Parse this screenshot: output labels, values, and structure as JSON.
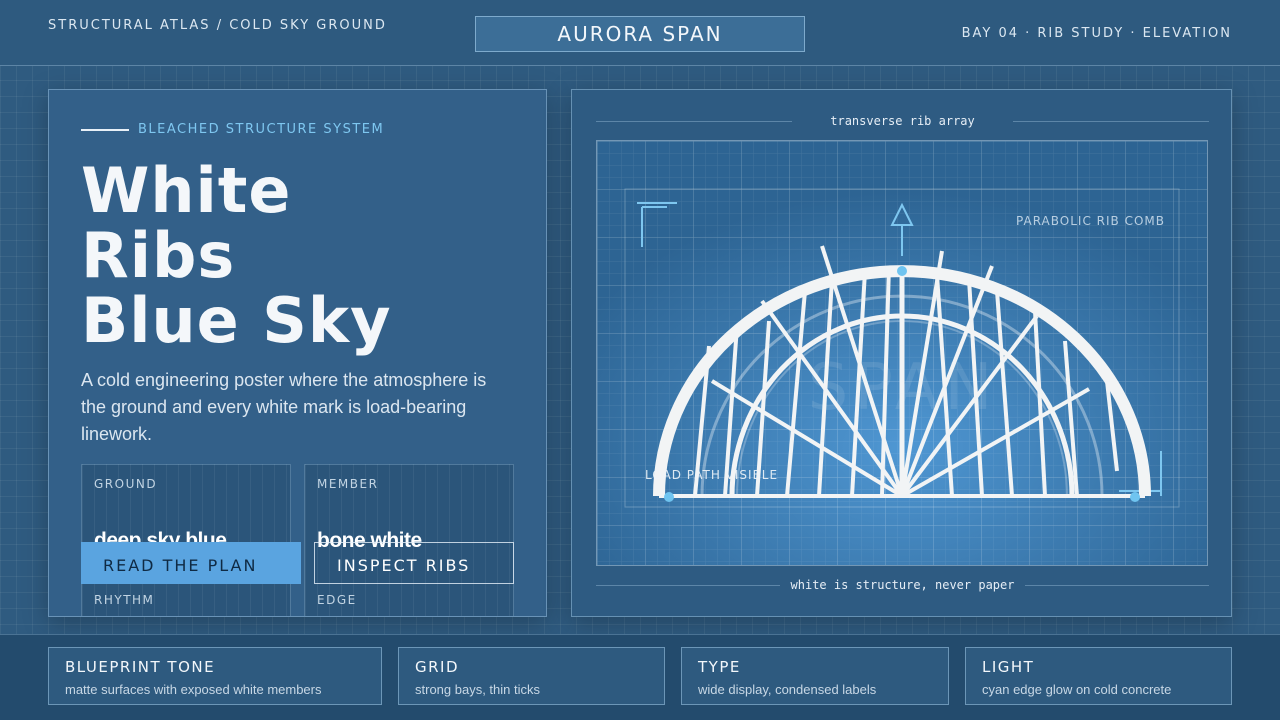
{
  "header": {
    "breadcrumb": "STRUCTURAL ATLAS / COLD SKY GROUND",
    "title": "AURORA SPAN",
    "meta": "BAY 04 · RIB STUDY · ELEVATION"
  },
  "hero": {
    "eyebrow": "BLEACHED STRUCTURE SYSTEM",
    "headline": [
      "White",
      "Ribs",
      "Blue Sky"
    ],
    "lede": "A cold engineering poster where the atmosphere is the ground and every white mark is load-bearing linework.",
    "specs": [
      {
        "label": "GROUND",
        "value": "deep sky blue",
        "label2": "RHYTHM"
      },
      {
        "label": "MEMBER",
        "value": "bone white",
        "label2": "EDGE"
      }
    ],
    "primary_button": "READ THE PLAN",
    "secondary_button": "INSPECT RIBS"
  },
  "diagram": {
    "caption_top": "transverse rib array",
    "caption_bottom": "white is structure, never paper",
    "label_comb": "PARABOLIC RIB COMB",
    "label_load": "LOAD PATH VISIBLE",
    "watermark": "SPAN"
  },
  "features": [
    {
      "title": "BLUEPRINT TONE",
      "desc": "matte surfaces with exposed white members"
    },
    {
      "title": "GRID",
      "desc": "strong bays, thin ticks"
    },
    {
      "title": "TYPE",
      "desc": "wide display, condensed labels"
    },
    {
      "title": "LIGHT",
      "desc": "cyan edge glow on cold concrete"
    }
  ],
  "colors": {
    "ground": "#2f5b80",
    "member": "#f2f4f5",
    "accent": "#5aa4e0",
    "cyan": "#7ec7f0"
  }
}
